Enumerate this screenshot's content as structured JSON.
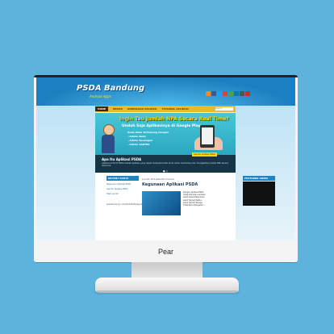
{
  "monitor": {
    "brand": "Pear"
  },
  "site": {
    "logo": "PSDA Bandung",
    "logo_sub": "Android Apps",
    "nav": [
      "HOME",
      "BERITA",
      "DOWNLOAD APLIKASI",
      "TUTORIAL APLIKASI"
    ],
    "search_placeholder": "Search",
    "banner": {
      "title": "Ingin Tau Jumlah NPA Secara Real Time?",
      "subtitle": "Unduh Saja Aplikasinya di Google Play",
      "lines": [
        "Anda Akan Terhubung Dengan",
        "~Admin Balai",
        "~Admin Keuangan",
        "~Admin SARTEK"
      ],
      "button": "Apa Itu Aplikasi PSDA",
      "caption": "Apa Itu Aplikasi PSDA",
      "text": "Aplikasi Android PSDA adalah aplikasi yang dapat mempermudah anda untuk memantau dan mengetahui jumlah NPA secara real time."
    },
    "sidebar_left": {
      "header": "RECENT POSTS",
      "links": [
        "Keguanan Aplikasi PSDA",
        "Apa Itu Aplikasi PSDA",
        "Hello world!"
      ],
      "address": "psdabandung.com/2016/06/28/apa-itu-aplikasi-psda"
    },
    "post": {
      "meta": "June 9th, 2016  Default  No Comment",
      "title": "Kegunaan Aplikasi PSDA",
      "text": "Dengan Aplikasi PSDA maka kita akan semakin Lebih Cepat Pelayanan, Lebih Hemat Waktu, Lebih Hemat Tenaga, Tidak Perlu Mengantri..."
    },
    "sidebar_right": {
      "header": "FEATURED VIDEO"
    }
  },
  "colors": {
    "background": "#5eb3dd",
    "nav": "#eab92e",
    "header": "#1c80c0",
    "accent": "#1b86c5"
  }
}
